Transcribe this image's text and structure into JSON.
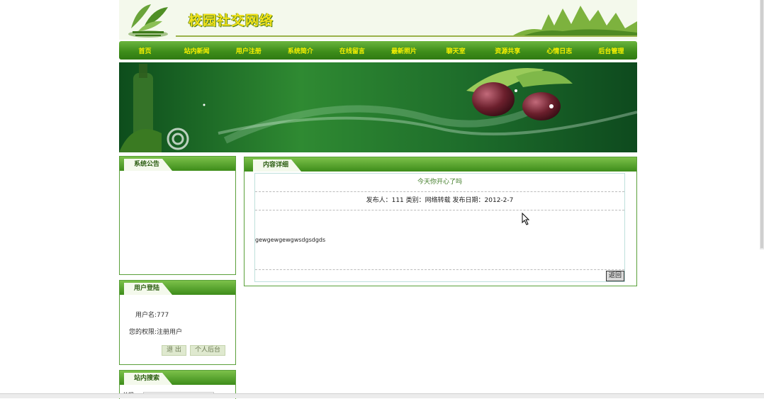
{
  "header": {
    "site_title": "校园社交网络"
  },
  "nav": {
    "items": [
      "首页",
      "站内新闻",
      "用户注册",
      "系统简介",
      "在线留言",
      "最新照片",
      "聊天室",
      "资源共享",
      "心情日志",
      "后台管理"
    ]
  },
  "sidebar": {
    "announcement": {
      "title": "系统公告"
    },
    "login": {
      "title": "用户登陆",
      "username_line": "用户名:777",
      "permission_line": "您的权限:注册用户",
      "logout_label": "退 出",
      "personal_label": "个人后台"
    },
    "search": {
      "title": "站内搜索",
      "label": "关键"
    }
  },
  "detail": {
    "title": "内容详细",
    "post_title": "今天你开心了吗",
    "meta": "发布人：111  类别：网络转载  发布日期：2012-2-7",
    "content": "gewgewgewgwsdgsdgds",
    "back_label": "返回"
  },
  "colors": {
    "nav_green": "#3f8e1b",
    "nav_text": "#f6f000",
    "accent": "#5aa03a"
  }
}
